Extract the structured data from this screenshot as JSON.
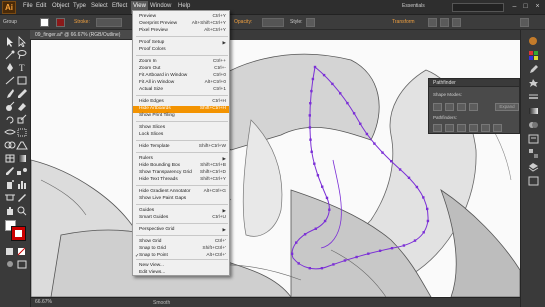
{
  "app": {
    "logo": "Ai"
  },
  "menubar": {
    "items": [
      "File",
      "Edit",
      "Object",
      "Type",
      "Select",
      "Effect",
      "View",
      "Window",
      "Help"
    ],
    "workspace": "Essentials"
  },
  "controlbar": {
    "group_label": "Group",
    "stroke_label": "Stroke:",
    "opacity_label": "Opacity:",
    "style_label": "Style:",
    "transform_label": "Transform"
  },
  "document": {
    "tab_title": "09_finger.ai* @ 66.67% (RGB/Outline)"
  },
  "statusbar": {
    "zoom": "66.67%",
    "status": "Smooth"
  },
  "pathfinder": {
    "title": "Pathfinder",
    "shape_modes_label": "Shape Modes:",
    "pathfinders_label": "Pathfinders:",
    "expand_label": "Expand"
  },
  "view_menu": {
    "items": [
      {
        "label": "Preview",
        "shortcut": "Ctrl+Y"
      },
      {
        "label": "Overprint Preview",
        "shortcut": "Alt+Shift+Ctrl+Y"
      },
      {
        "label": "Pixel Preview",
        "shortcut": "Alt+Ctrl+Y"
      },
      {
        "label": "Proof Setup",
        "submenu": true
      },
      {
        "label": "Proof Colors"
      },
      {
        "label": "Zoom In",
        "shortcut": "Ctrl++"
      },
      {
        "label": "Zoom Out",
        "shortcut": "Ctrl+-"
      },
      {
        "label": "Fit Artboard in Window",
        "shortcut": "Ctrl+0"
      },
      {
        "label": "Fit All in Window",
        "shortcut": "Alt+Ctrl+0"
      },
      {
        "label": "Actual Size",
        "shortcut": "Ctrl+1"
      },
      {
        "label": "Hide Edges",
        "shortcut": "Ctrl+H"
      },
      {
        "label": "Hide Artboards",
        "shortcut": "Shift+Ctrl+H",
        "highlighted": true
      },
      {
        "label": "Show Print Tiling"
      },
      {
        "label": "Show Slices"
      },
      {
        "label": "Lock Slices"
      },
      {
        "label": "Hide Template",
        "shortcut": "Shift+Ctrl+W"
      },
      {
        "label": "Rulers",
        "submenu": true
      },
      {
        "label": "Hide Bounding Box",
        "shortcut": "Shift+Ctrl+B"
      },
      {
        "label": "Show Transparency Grid",
        "shortcut": "Shift+Ctrl+D"
      },
      {
        "label": "Hide Text Threads",
        "shortcut": "Shift+Ctrl+Y"
      },
      {
        "label": "Hide Gradient Annotator",
        "shortcut": "Alt+Ctrl+G"
      },
      {
        "label": "Show Live Paint Gaps"
      },
      {
        "label": "Guides",
        "submenu": true
      },
      {
        "label": "Smart Guides",
        "shortcut": "Ctrl+U"
      },
      {
        "label": "Perspective Grid",
        "submenu": true
      },
      {
        "label": "Show Grid",
        "shortcut": "Ctrl+'"
      },
      {
        "label": "Snap to Grid",
        "shortcut": "Shift+Ctrl+'"
      },
      {
        "label": "Snap to Point",
        "shortcut": "Alt+Ctrl+'",
        "checked": true
      },
      {
        "label": "New View..."
      },
      {
        "label": "Edit Views..."
      }
    ]
  },
  "colors": {
    "menu_highlight": "#f39300",
    "anchor_points": "#7b2fd6",
    "app_orange": "#f7a23b"
  }
}
